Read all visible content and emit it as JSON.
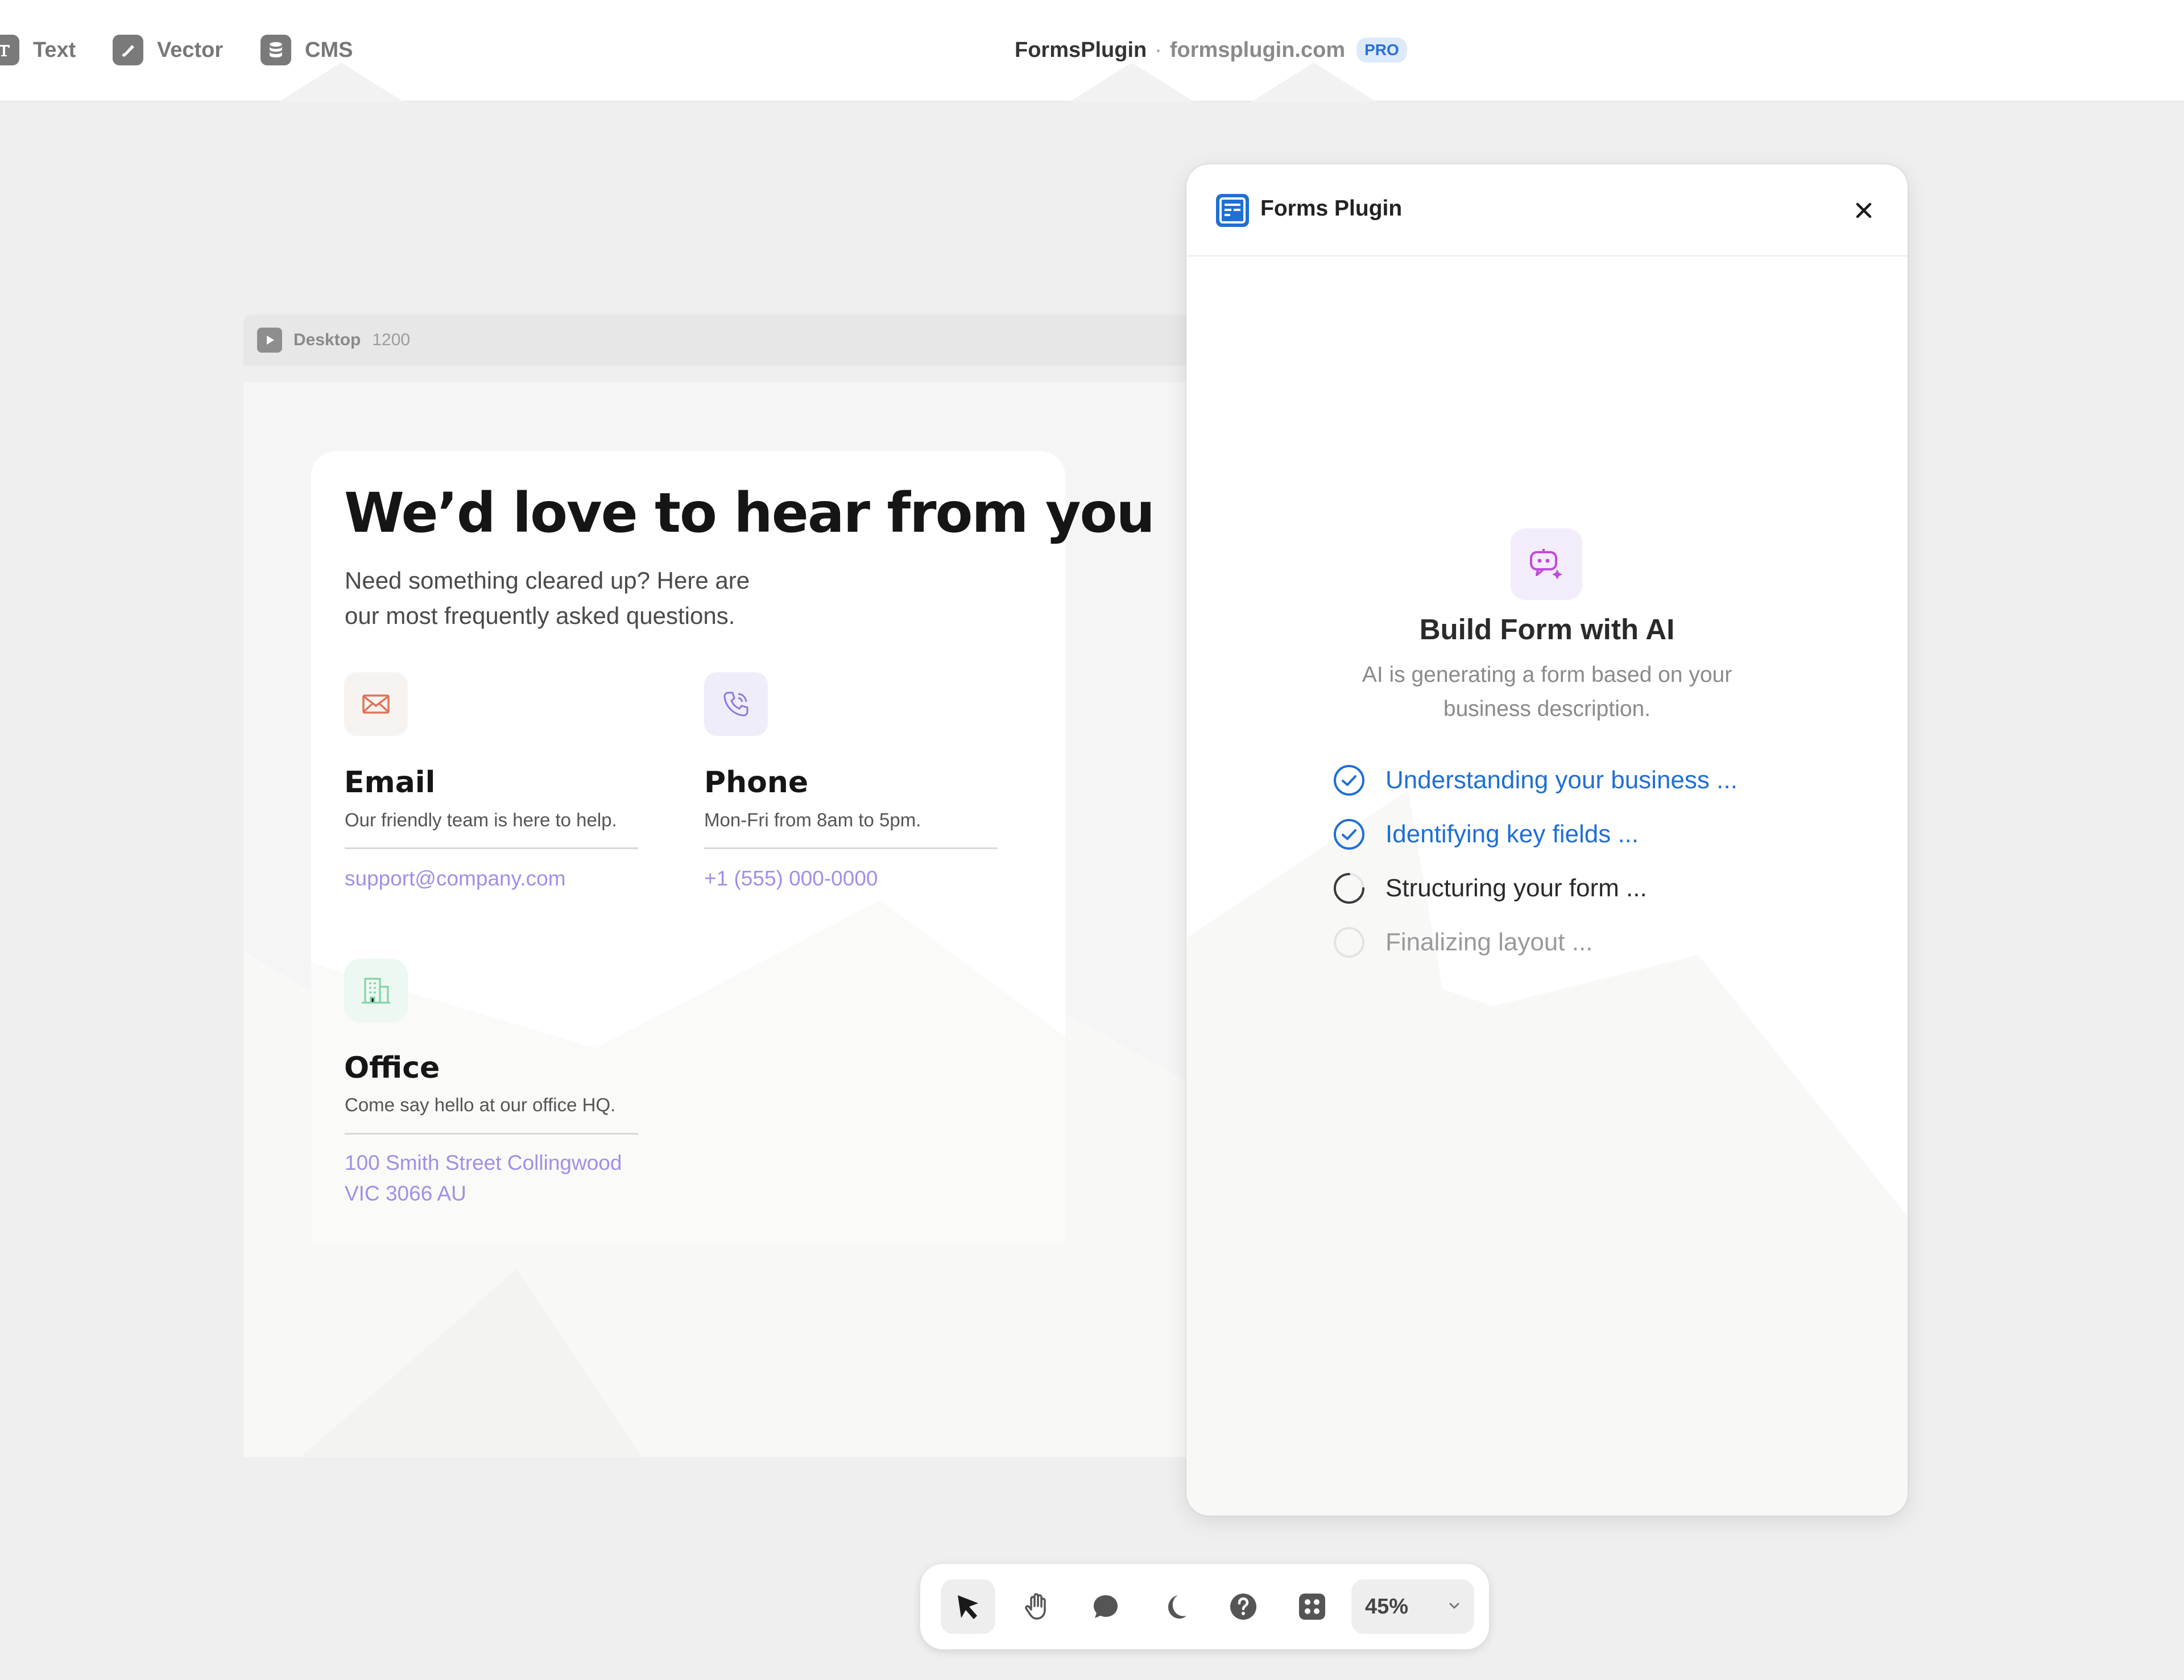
{
  "toolbar": {
    "tools": [
      {
        "label": "Text",
        "icon": "text-tool-icon"
      },
      {
        "label": "Vector",
        "icon": "vector-tool-icon"
      },
      {
        "label": "CMS",
        "icon": "cms-database-icon"
      }
    ],
    "project_name": "FormsPlugin",
    "separator": "·",
    "domain": "formsplugin.com",
    "badge": "PRO"
  },
  "canvas": {
    "frame_name": "Desktop",
    "frame_width": "1200",
    "card": {
      "title": "We’d love to hear from you",
      "subtitle": "Need something cleared up? Here are our most frequently asked questions.",
      "contacts": [
        {
          "icon": "mail-icon",
          "title": "Email",
          "desc": "Our friendly team is here to help.",
          "link": "support@company.com"
        },
        {
          "icon": "phone-icon",
          "title": "Phone",
          "desc": "Mon-Fri from 8am to 5pm.",
          "link": "+1 (555) 000-0000"
        },
        {
          "icon": "building-icon",
          "title": "Office",
          "desc": "Come say hello at our office HQ.",
          "link": "100 Smith Street Collingwood VIC 3066 AU"
        }
      ]
    }
  },
  "plugin_panel": {
    "title": "Forms Plugin",
    "heading": "Build Form with AI",
    "description": "AI is generating a form based on your business description.",
    "steps": [
      {
        "label": "Understanding your business ...",
        "status": "done"
      },
      {
        "label": "Identifying key fields ...",
        "status": "done"
      },
      {
        "label": "Structuring your form ...",
        "status": "in-progress"
      },
      {
        "label": "Finalizing layout ...",
        "status": "pending"
      }
    ]
  },
  "bottom_toolbar": {
    "tools": [
      "select-cursor-icon",
      "hand-pan-icon",
      "comment-icon",
      "dark-mode-moon-icon",
      "help-icon",
      "plugins-grid-icon"
    ],
    "zoom": "45%"
  },
  "colors": {
    "accent_blue": "#1f6fd6",
    "link_purple": "#a38ee6",
    "ai_magenta": "#c24bd6",
    "canvas_bg": "#efefef"
  }
}
